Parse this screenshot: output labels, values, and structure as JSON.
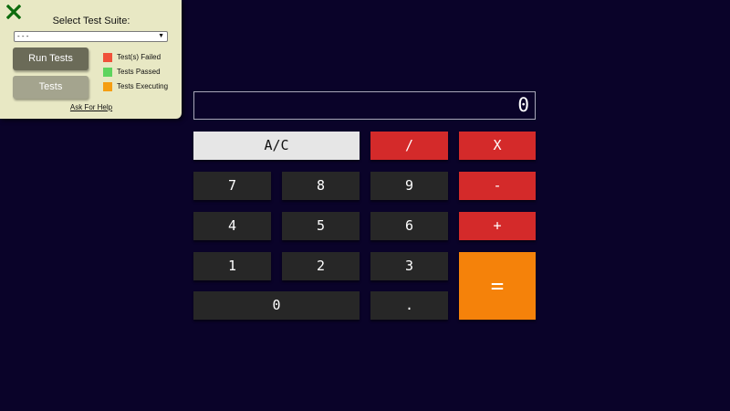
{
  "test_panel": {
    "close_icon": "close-x-icon",
    "title": "Select Test Suite:",
    "suite_select": {
      "selected": "- - -",
      "chevron_icon": "chevron-down-icon"
    },
    "run_button": "Run Tests",
    "tests_button": "Tests",
    "legend": [
      {
        "label": "Test(s) Failed",
        "color": "#f0513a"
      },
      {
        "label": "Tests Passed",
        "color": "#5ed45e"
      },
      {
        "label": "Tests Executing",
        "color": "#f59e12"
      }
    ],
    "help_link": "Ask For Help"
  },
  "calculator": {
    "display_value": "0",
    "keys": {
      "clear": "A/C",
      "divide": "/",
      "multiply": "X",
      "subtract": "-",
      "add": "+",
      "equals": "=",
      "decimal": ".",
      "seven": "7",
      "eight": "8",
      "nine": "9",
      "four": "4",
      "five": "5",
      "six": "6",
      "one": "1",
      "two": "2",
      "three": "3",
      "zero": "0"
    }
  },
  "colors": {
    "background": "#0a0329",
    "number_key": "#272727",
    "operator_key": "#d42a2a",
    "clear_key": "#e6e6e6",
    "equals_key": "#f5820a",
    "panel": "#e8e8c4"
  }
}
